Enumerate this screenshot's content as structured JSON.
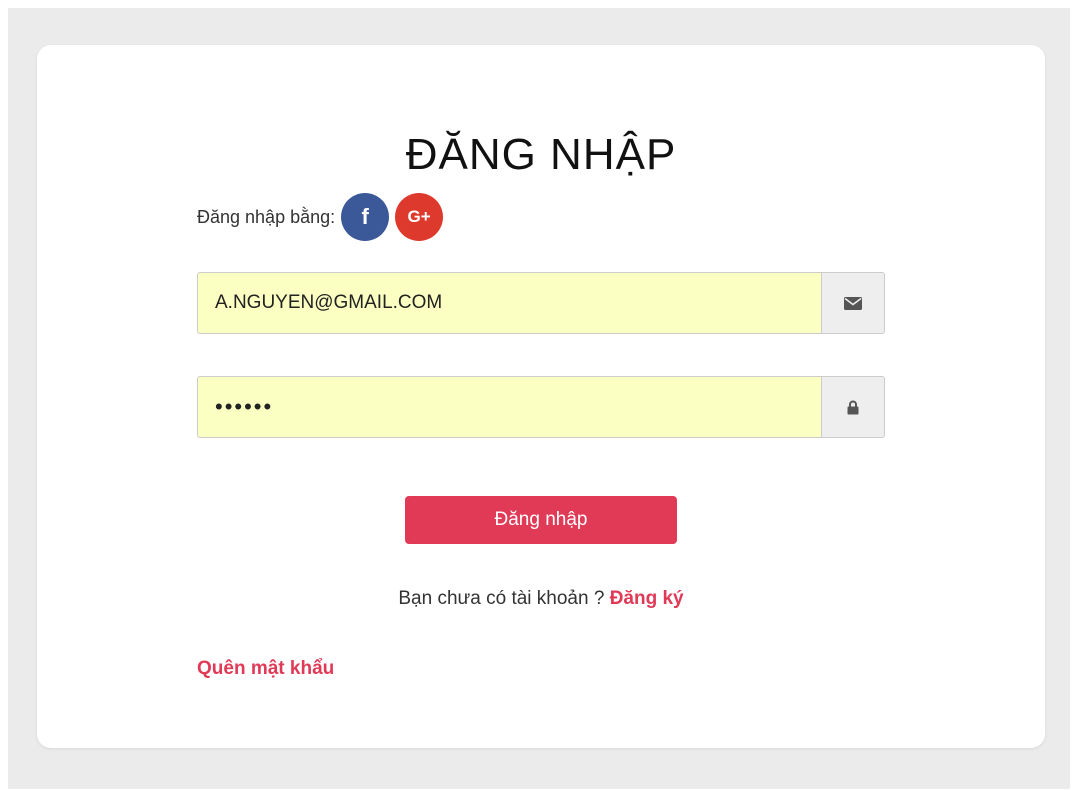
{
  "login": {
    "title": "ĐĂNG NHẬP",
    "social_label": "Đăng nhập bằng:",
    "social": {
      "facebook": {
        "glyph": "f",
        "icon": "facebook-icon",
        "color": "#3b5998"
      },
      "google": {
        "glyph": "G+",
        "icon": "google-plus-icon",
        "color": "#dd3a2d"
      }
    },
    "email": {
      "value": "A.NGUYEN@GMAIL.COM",
      "icon": "envelope-icon"
    },
    "password": {
      "value": "••••••",
      "icon": "lock-icon"
    },
    "submit_label": "Đăng nhập",
    "signup_prompt": "Bạn chưa có tài khoản ? ",
    "signup_link": "Đăng ký",
    "forgot_link": "Quên mật khẩu"
  },
  "colors": {
    "accent": "#e03a57",
    "input_autofill_bg": "#fbffc2",
    "page_bg": "#ebebeb",
    "card_bg": "#ffffff"
  }
}
